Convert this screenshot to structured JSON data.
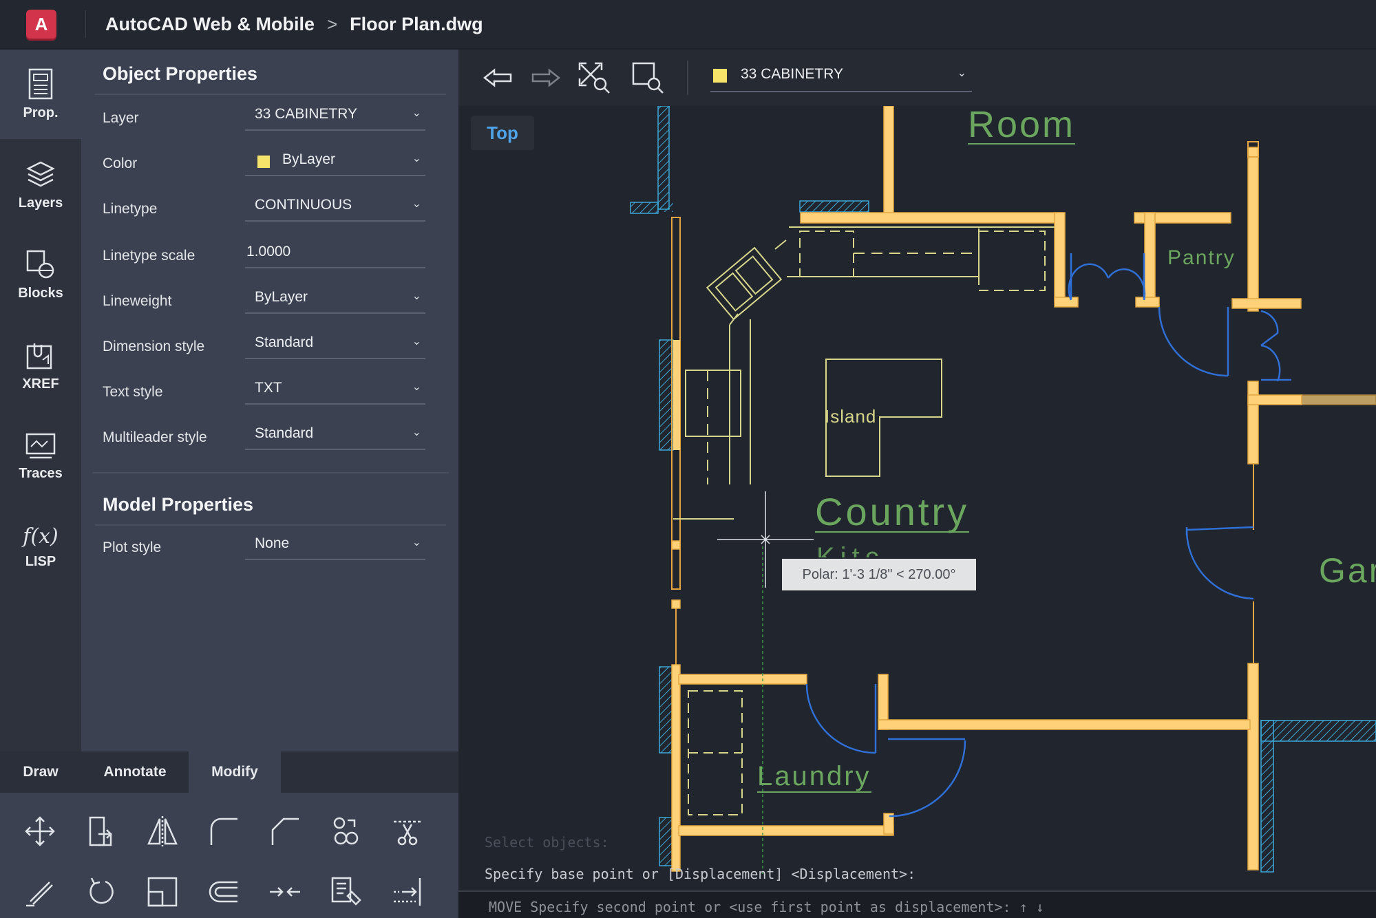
{
  "app": {
    "logo": "A",
    "name": "AutoCAD Web & Mobile",
    "separator": ">",
    "file": "Floor Plan.dwg"
  },
  "rail": [
    {
      "label": "Prop.",
      "icon": "properties-icon",
      "active": true
    },
    {
      "label": "Layers",
      "icon": "layers-icon"
    },
    {
      "label": "Blocks",
      "icon": "blocks-icon"
    },
    {
      "label": "XREF",
      "icon": "xref-icon"
    },
    {
      "label": "Traces",
      "icon": "traces-icon"
    },
    {
      "label": "LISP",
      "icon": "lisp-icon",
      "glyph": "f(x)"
    }
  ],
  "object_properties": {
    "title": "Object Properties",
    "rows": [
      {
        "label": "Layer",
        "value": "33 CABINETRY"
      },
      {
        "label": "Color",
        "value": "ByLayer",
        "swatch": "#f5e36a"
      },
      {
        "label": "Linetype",
        "value": "CONTINUOUS"
      },
      {
        "label": "Linetype scale",
        "value": "1.0000"
      },
      {
        "label": "Lineweight",
        "value": "ByLayer"
      },
      {
        "label": "Dimension style",
        "value": "Standard"
      },
      {
        "label": "Text style",
        "value": "TXT"
      },
      {
        "label": "Multileader style",
        "value": "Standard"
      }
    ]
  },
  "model_properties": {
    "title": "Model Properties",
    "rows": [
      {
        "label": "Plot style",
        "value": "None"
      }
    ]
  },
  "tabs": [
    {
      "label": "Draw"
    },
    {
      "label": "Annotate"
    },
    {
      "label": "Modify",
      "active": true
    }
  ],
  "modify_tools": [
    "move-icon",
    "copy-icon",
    "mirror-icon",
    "fillet-icon",
    "chamfer-icon",
    "array-icon",
    "trim-icon",
    "erase-icon",
    "rotate-icon",
    "scale-icon",
    "offset-icon",
    "join-icon",
    "match-properties-icon",
    "extend-icon"
  ],
  "toolbar": {
    "buttons": [
      "undo-icon",
      "redo-icon",
      "zoom-extents-icon",
      "zoom-window-icon"
    ],
    "current_layer": "33 CABINETRY",
    "layer_color": "#f5e36a"
  },
  "viewport": {
    "view": "Top"
  },
  "drawing_labels": {
    "room": "Room",
    "pantry": "Pantry",
    "island": "Island",
    "country": "Country",
    "kitchen_partial": "Kitc",
    "garage_partial": "Gar",
    "laundry": "Laundry"
  },
  "tooltip": "Polar: 1'-3 1/8\" < 270.00°",
  "command": {
    "faded": "Select objects:",
    "current": "Specify base point or [Displacement] <Displacement>:",
    "input": "MOVE Specify second point or <use first point as displacement>: ↑ ↓"
  },
  "colors": {
    "wall": "#ffd27a",
    "cabinet": "#d7d68b",
    "door": "#2f6fd6",
    "hatch": "#3da8d8",
    "label": "#6aa65e",
    "bg": "#21252d"
  }
}
